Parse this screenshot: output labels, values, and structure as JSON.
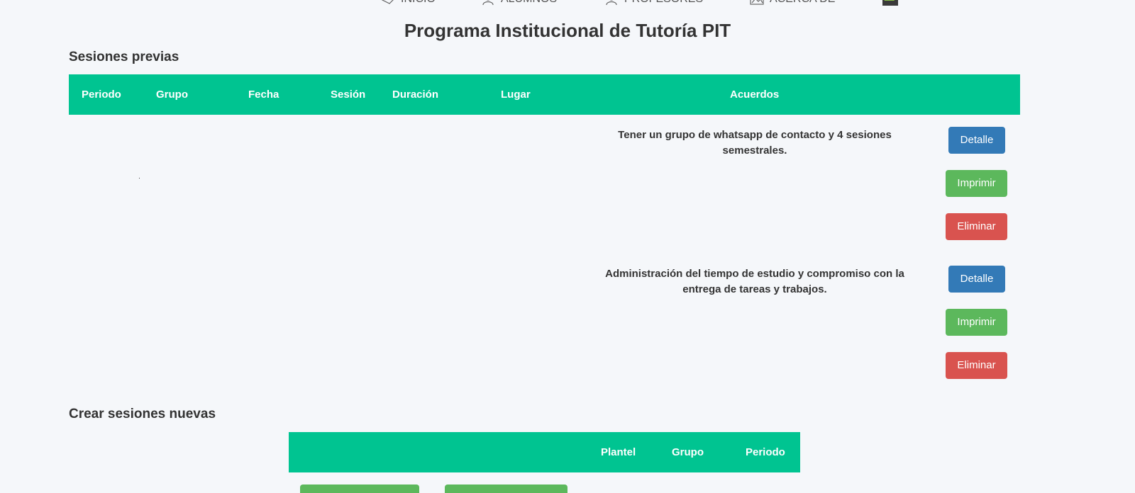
{
  "nav": {
    "items": [
      {
        "label": "INICIO",
        "icon": "handshake-icon"
      },
      {
        "label": "ALUMNOS",
        "icon": "user-icon"
      },
      {
        "label": "PROFESORES",
        "icon": "user-icon"
      },
      {
        "label": "ACERCA DE",
        "icon": "image-icon"
      }
    ]
  },
  "page": {
    "title": "Programa Institucional de Tutoría PIT"
  },
  "previous": {
    "title": "Sesiones previas",
    "columns": [
      "Periodo",
      "Grupo",
      "Fecha",
      "Sesión",
      "Duración",
      "Lugar",
      "Acuerdos"
    ],
    "rows": [
      {
        "acuerdos": "Tener un grupo de whatsapp de contacto y 4 sesiones semestrales.",
        "detail": "Detalle",
        "print": "Imprimir",
        "delete": "Eliminar"
      },
      {
        "acuerdos": "Administración del tiempo de estudio y compromiso con la entrega de tareas y trabajos.",
        "detail": "Detalle",
        "print": "Imprimir",
        "delete": "Eliminar"
      }
    ]
  },
  "create": {
    "title": "Crear sesiones nuevas",
    "columns": [
      "Plantel",
      "Grupo",
      "Periodo"
    ]
  },
  "colors": {
    "header": "#00c491",
    "blue": "#337ab7",
    "green": "#5cb85c",
    "red": "#d9534f"
  }
}
